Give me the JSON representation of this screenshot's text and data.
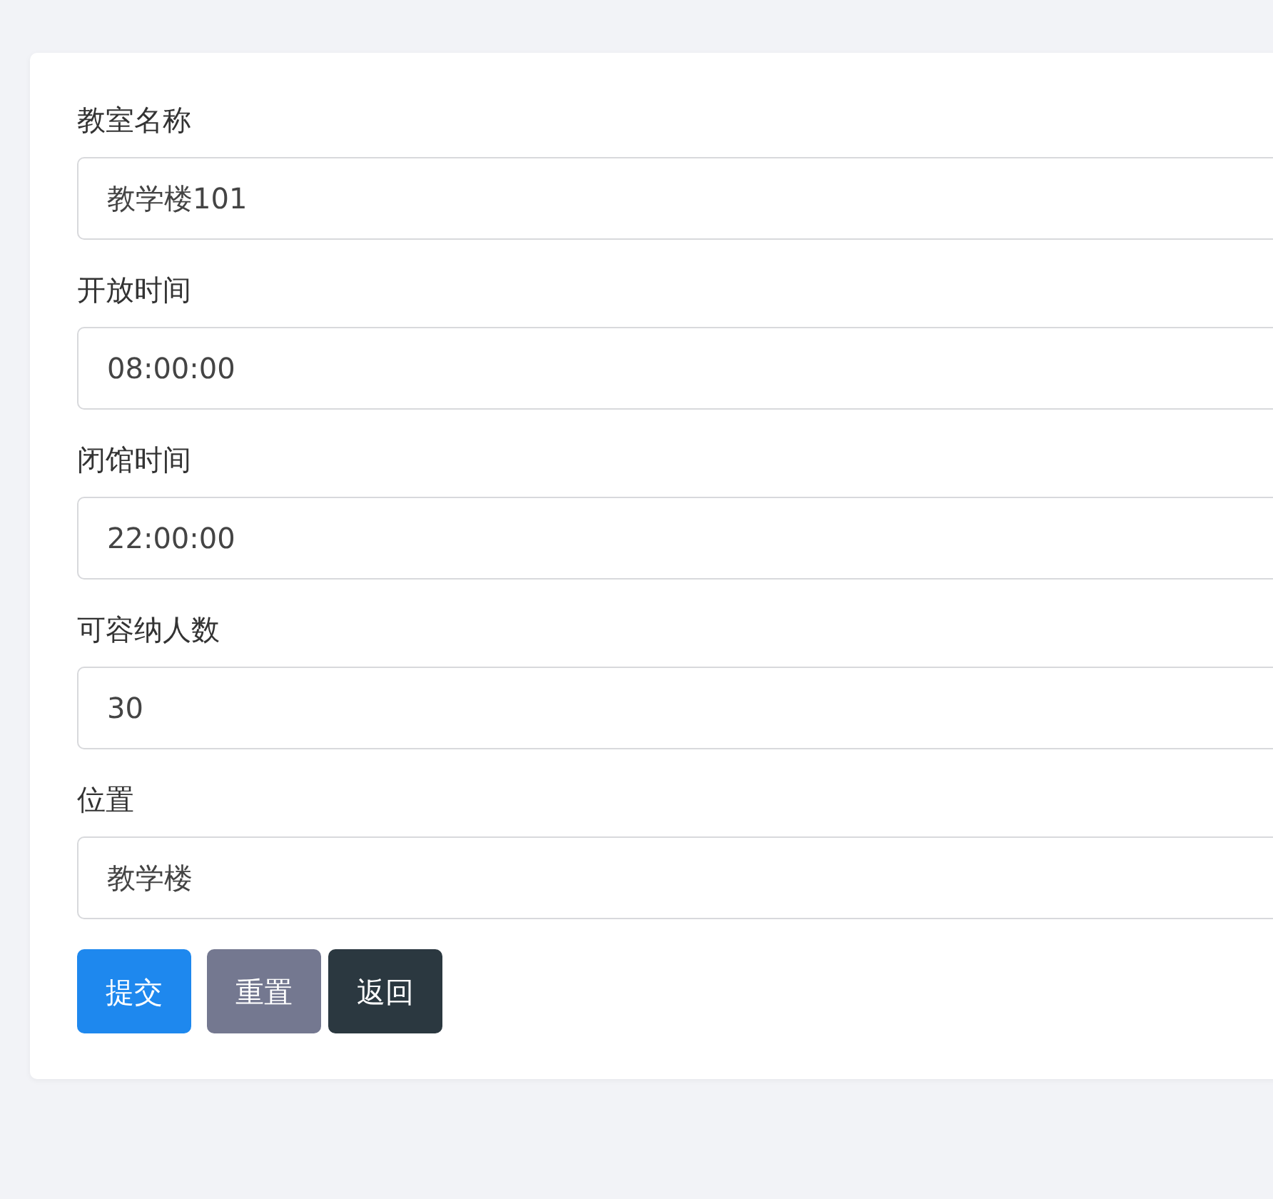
{
  "form": {
    "fields": [
      {
        "label": "教室名称",
        "value": "教学楼101"
      },
      {
        "label": "开放时间",
        "value": "08:00:00"
      },
      {
        "label": "闭馆时间",
        "value": "22:00:00"
      },
      {
        "label": "可容纳人数",
        "value": "30"
      },
      {
        "label": "位置",
        "value": "教学楼"
      }
    ],
    "buttons": [
      {
        "label": "提交",
        "kind": "primary"
      },
      {
        "label": "重置",
        "kind": "secondary"
      },
      {
        "label": "返回",
        "kind": "dark"
      }
    ]
  }
}
